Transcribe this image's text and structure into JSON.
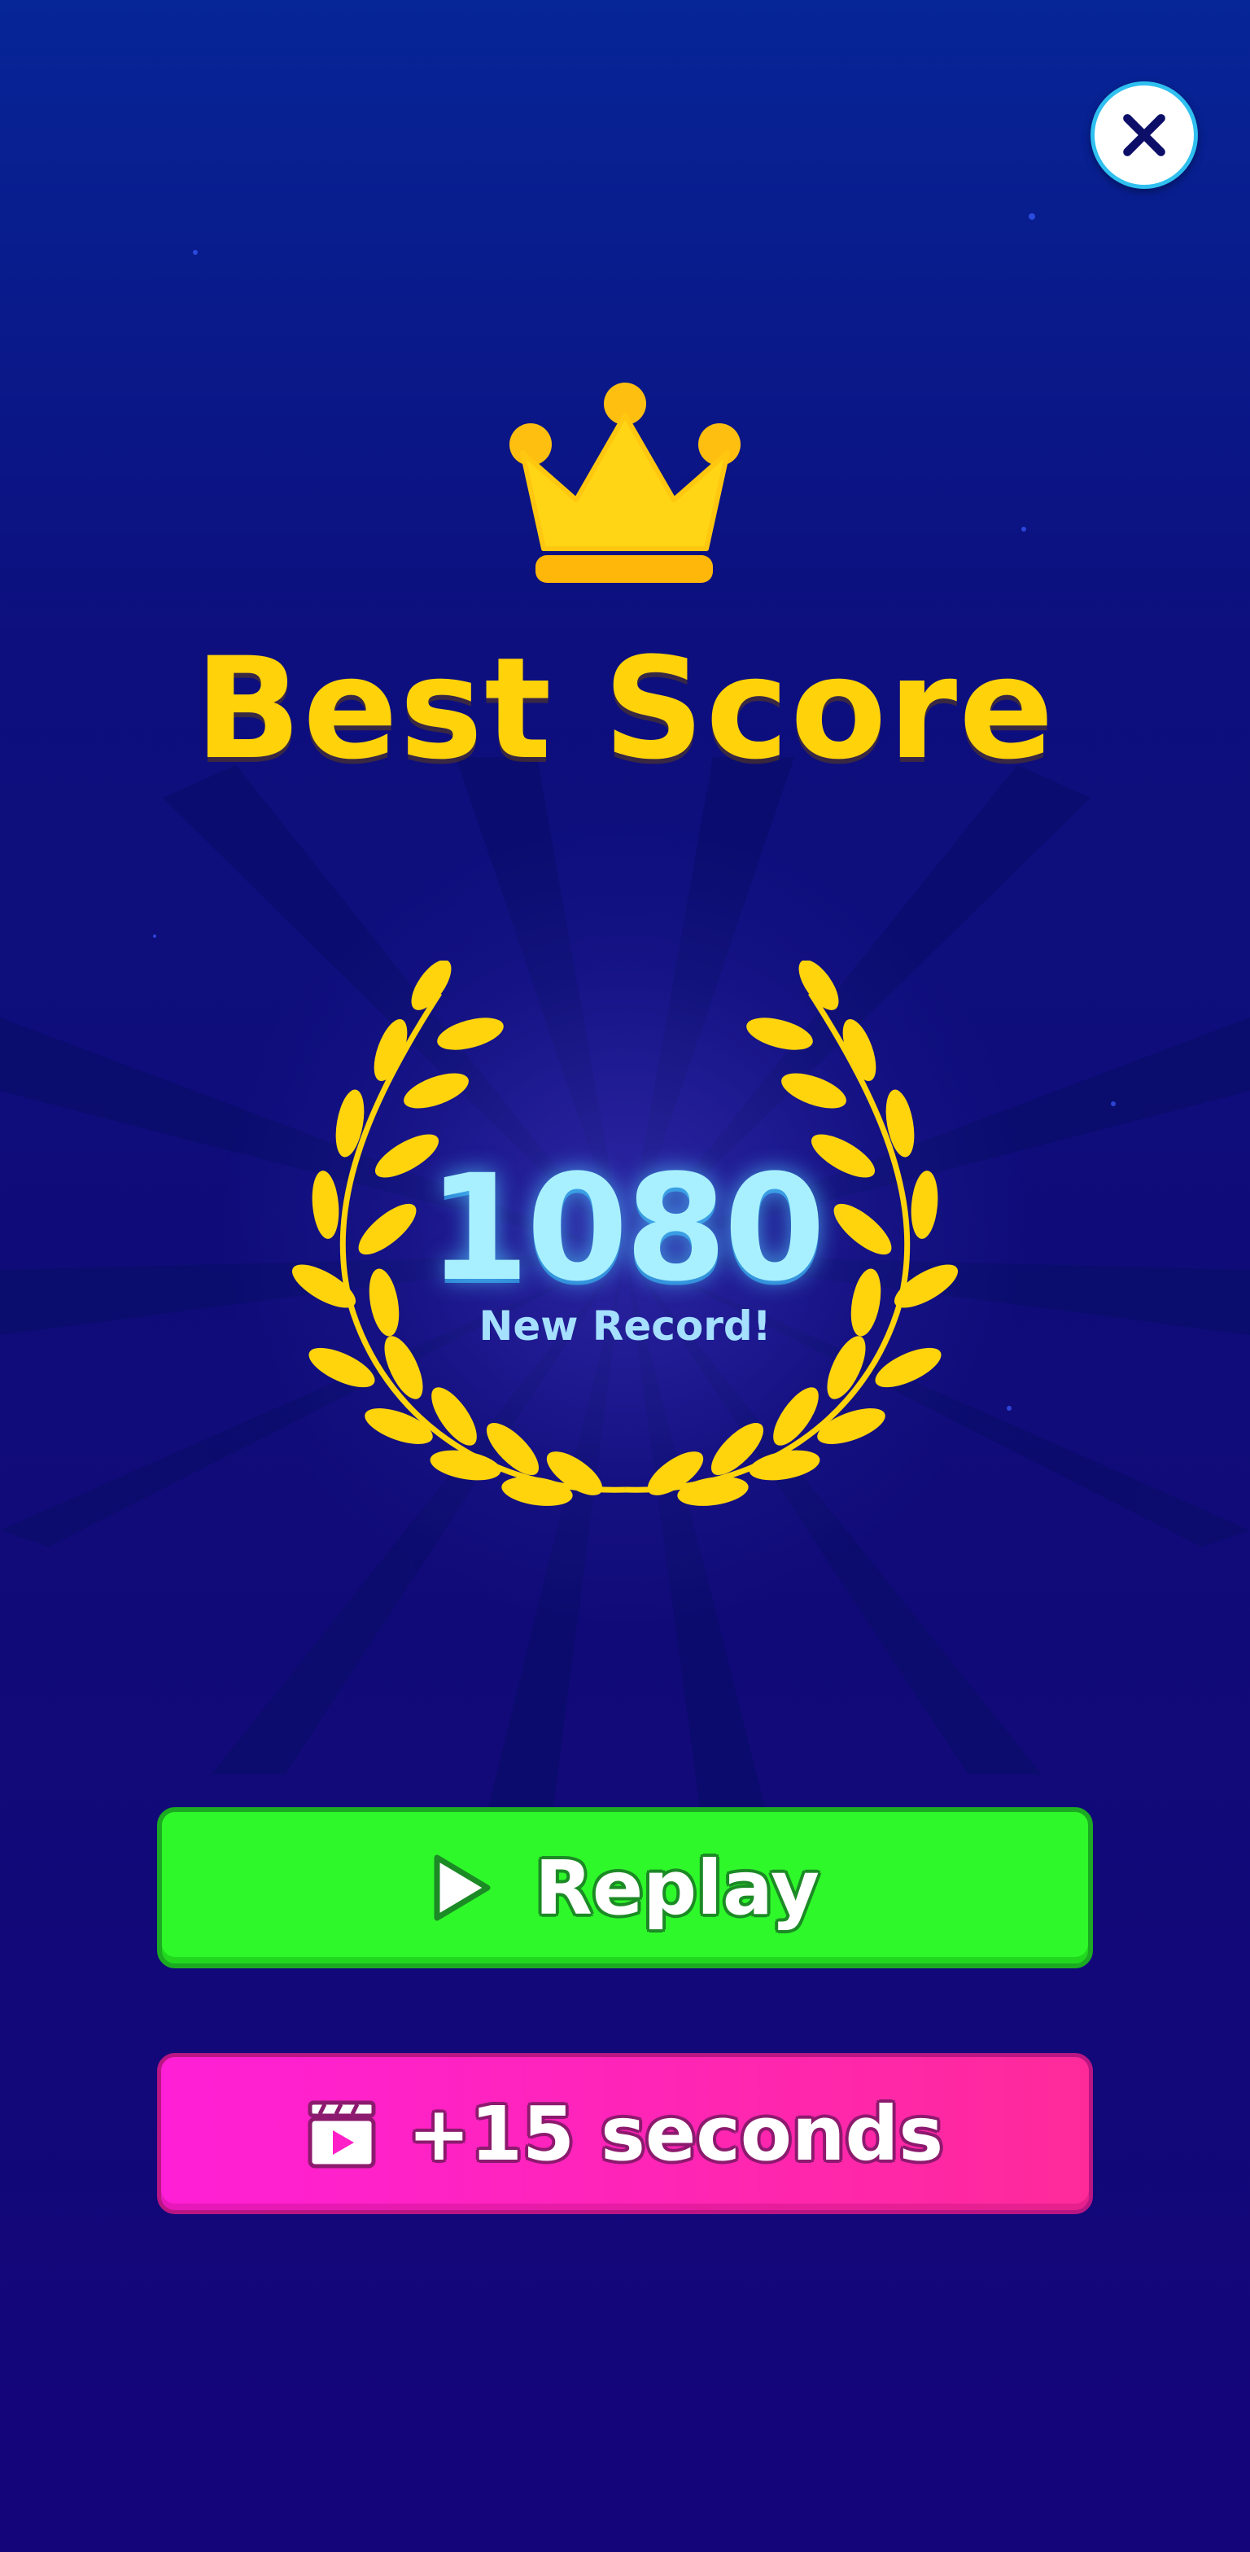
{
  "dialog": {
    "title": "Best Score",
    "score": "1080",
    "subtitle": "New Record!"
  },
  "buttons": {
    "close_icon": "close-icon",
    "replay_label": "Replay",
    "replay_icon": "play-icon",
    "bonus_label": "+15 seconds",
    "bonus_icon": "video-clapper-icon"
  },
  "colors": {
    "background": "#0d0f7e",
    "title": "#ffd20a",
    "score": "#a8f0ff",
    "replay_button": "#2ef82a",
    "bonus_button": "#ff1fd6",
    "gold": "#ffd20a"
  },
  "icons": {
    "crown": "crown-icon",
    "wreath": "laurel-wreath-icon"
  }
}
